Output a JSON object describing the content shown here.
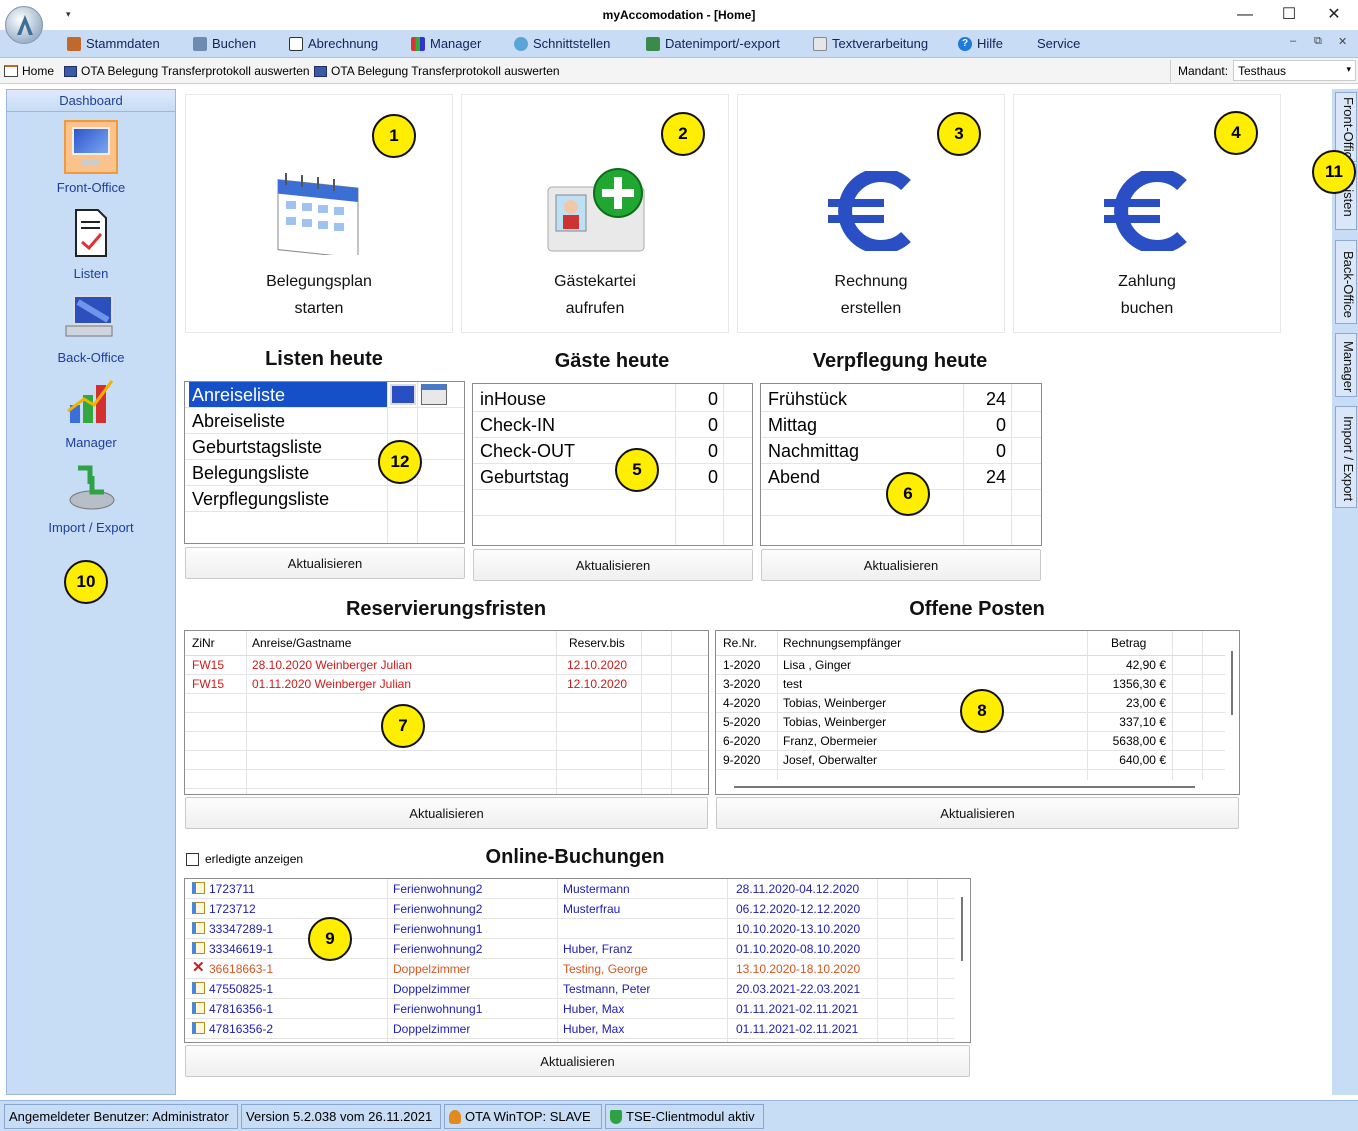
{
  "window": {
    "title": "myAccomodation - [Home]"
  },
  "menu": [
    "Stammdaten",
    "Buchen",
    "Abrechnung",
    "Manager",
    "Schnittstellen",
    "Datenimport/-export",
    "Textverarbeitung",
    "Hilfe",
    "Service"
  ],
  "quickbar": {
    "items": [
      "Home",
      "OTA Belegung Transferprotokoll auswerten",
      "OTA Belegung Transferprotokoll auswerten"
    ],
    "mandant_label": "Mandant:",
    "mandant_value": "Testhaus"
  },
  "sidebar": {
    "header": "Dashboard",
    "items": [
      "Front-Office",
      "Listen",
      "Back-Office",
      "Manager",
      "Import / Export"
    ]
  },
  "right_tabs": [
    "Front-Office",
    "Listen",
    "Back-Office",
    "Manager",
    "Import / Export"
  ],
  "tiles": [
    {
      "line1": "Belegungsplan",
      "line2": "starten",
      "icon": "calendar-icon"
    },
    {
      "line1": "Gästekartei",
      "line2": "aufrufen",
      "icon": "add-guest-card-icon"
    },
    {
      "line1": "Rechnung",
      "line2": "erstellen",
      "icon": "euro-icon"
    },
    {
      "line1": "Zahlung",
      "line2": "buchen",
      "icon": "euro-icon"
    }
  ],
  "listen_heute": {
    "title": "Listen heute",
    "items": [
      "Anreiseliste",
      "Abreiseliste",
      "Geburtstagsliste",
      "Belegungsliste",
      "Verpflegungsliste"
    ],
    "button": "Aktualisieren"
  },
  "gaeste_heute": {
    "title": "Gäste heute",
    "rows": [
      {
        "label": "inHouse",
        "value": "0"
      },
      {
        "label": "Check-IN",
        "value": "0"
      },
      {
        "label": "Check-OUT",
        "value": "0"
      },
      {
        "label": "Geburtstag",
        "value": "0"
      }
    ],
    "button": "Aktualisieren"
  },
  "verpflegung_heute": {
    "title": "Verpflegung heute",
    "rows": [
      {
        "label": "Frühstück",
        "value": "24"
      },
      {
        "label": "Mittag",
        "value": "0"
      },
      {
        "label": "Nachmittag",
        "value": "0"
      },
      {
        "label": "Abend",
        "value": "24"
      }
    ],
    "button": "Aktualisieren"
  },
  "reservierungsfristen": {
    "title": "Reservierungsfristen",
    "columns": [
      "ZiNr",
      "Anreise/Gastname",
      "Reserv.bis"
    ],
    "rows": [
      {
        "zinr": "FW15",
        "name": "28.10.2020 Weinberger Julian",
        "bis": "12.10.2020"
      },
      {
        "zinr": "FW15",
        "name": "01.11.2020 Weinberger Julian",
        "bis": "12.10.2020"
      }
    ],
    "button": "Aktualisieren"
  },
  "offene_posten": {
    "title": "Offene Posten",
    "columns": [
      "Re.Nr.",
      "Rechnungsempfänger",
      "Betrag"
    ],
    "rows": [
      {
        "nr": "1-2020",
        "empf": "Lisa , Ginger",
        "betrag": "42,90 €"
      },
      {
        "nr": "3-2020",
        "empf": "test",
        "betrag": "1356,30 €"
      },
      {
        "nr": "4-2020",
        "empf": "Tobias, Weinberger",
        "betrag": "23,00 €"
      },
      {
        "nr": "5-2020",
        "empf": "Tobias, Weinberger",
        "betrag": "337,10 €"
      },
      {
        "nr": "6-2020",
        "empf": "Franz, Obermeier",
        "betrag": "5638,00 €"
      },
      {
        "nr": "9-2020",
        "empf": "Josef, Oberwalter",
        "betrag": "640,00 €"
      }
    ],
    "button": "Aktualisieren"
  },
  "online_buchungen": {
    "title": "Online-Buchungen",
    "checkbox_label": "erledigte anzeigen",
    "rows": [
      {
        "id": "1723711",
        "objekt": "Ferienwohnung2",
        "gast": "Mustermann",
        "zeitraum": "28.11.2020-04.12.2020",
        "state": "new"
      },
      {
        "id": "1723712",
        "objekt": "Ferienwohnung2",
        "gast": "Musterfrau",
        "zeitraum": "06.12.2020-12.12.2020",
        "state": "new"
      },
      {
        "id": "33347289-1",
        "objekt": "Ferienwohnung1",
        "gast": "",
        "zeitraum": "10.10.2020-13.10.2020",
        "state": "new"
      },
      {
        "id": "33346619-1",
        "objekt": "Ferienwohnung2",
        "gast": "Huber, Franz",
        "zeitraum": "01.10.2020-08.10.2020",
        "state": "new"
      },
      {
        "id": "36618663-1",
        "objekt": "Doppelzimmer",
        "gast": "Testing, George",
        "zeitraum": "13.10.2020-18.10.2020",
        "state": "cancelled"
      },
      {
        "id": "47550825-1",
        "objekt": "Doppelzimmer",
        "gast": "Testmann, Peter",
        "zeitraum": "20.03.2021-22.03.2021",
        "state": "new"
      },
      {
        "id": "47816356-1",
        "objekt": "Ferienwohnung1",
        "gast": "Huber, Max",
        "zeitraum": "01.11.2021-02.11.2021",
        "state": "new"
      },
      {
        "id": "47816356-2",
        "objekt": "Doppelzimmer",
        "gast": "Huber, Max",
        "zeitraum": "01.11.2021-02.11.2021",
        "state": "new"
      }
    ],
    "button": "Aktualisieren"
  },
  "markers": [
    "1",
    "2",
    "3",
    "4",
    "5",
    "6",
    "7",
    "8",
    "9",
    "10",
    "11",
    "12"
  ],
  "status": {
    "user": "Angemeldeter Benutzer: Administrator",
    "version": "Version 5.2.038 vom 26.11.2021",
    "ota": "OTA WinTOP: SLAVE",
    "tse": "TSE-Clientmodul aktiv"
  },
  "colors": {
    "accent": "#c9dcf5",
    "cancelled": "#d9541e",
    "booking": "#1c1cb8",
    "deadline": "#d11a1a",
    "selection": "#1550c8"
  }
}
